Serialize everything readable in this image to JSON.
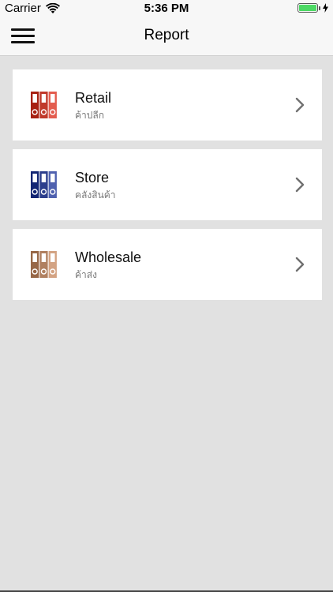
{
  "status_bar": {
    "carrier": "Carrier",
    "time": "5:36 PM",
    "battery_color": "#4cd964"
  },
  "nav": {
    "title": "Report",
    "menu_icon": "hamburger-menu-icon"
  },
  "reports": [
    {
      "title": "Retail",
      "subtitle": "ค้าปลีก",
      "icon": "folder-binders-icon",
      "icon_color": "#c0392b"
    },
    {
      "title": "Store",
      "subtitle": "คลังสินค้า",
      "icon": "folder-binders-icon",
      "icon_color": "#2c3e8c"
    },
    {
      "title": "Wholesale",
      "subtitle": "ค้าส่ง",
      "icon": "folder-binders-icon",
      "icon_color": "#b08060"
    }
  ]
}
